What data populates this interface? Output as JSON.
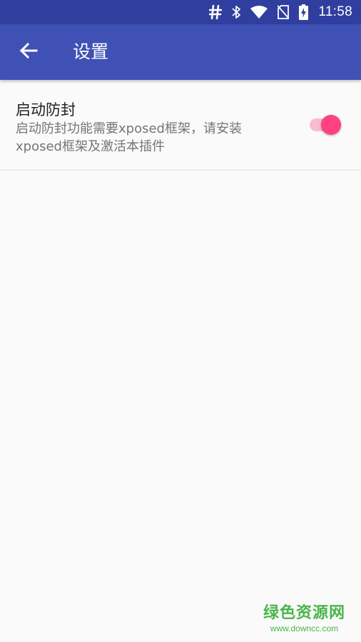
{
  "status_bar": {
    "time": "11:58",
    "icons": [
      "hash-icon",
      "bluetooth-icon",
      "wifi-icon",
      "no-sim-icon",
      "battery-charging-icon"
    ]
  },
  "app_bar": {
    "title": "设置",
    "back_icon": "arrow-back-icon"
  },
  "preferences": [
    {
      "title": "启动防封",
      "summary": "启动防封功能需要xposed框架，请安装xposed框架及激活本插件",
      "switch_on": true
    }
  ],
  "watermark": {
    "main": "绿色资源网",
    "sub": "www.downcc.com"
  },
  "colors": {
    "status_bar": "#303f9f",
    "app_bar": "#3f51b5",
    "accent": "#ff4081",
    "track": "#f8bbd0",
    "background": "#fafafa",
    "watermark": "#49b54c"
  }
}
